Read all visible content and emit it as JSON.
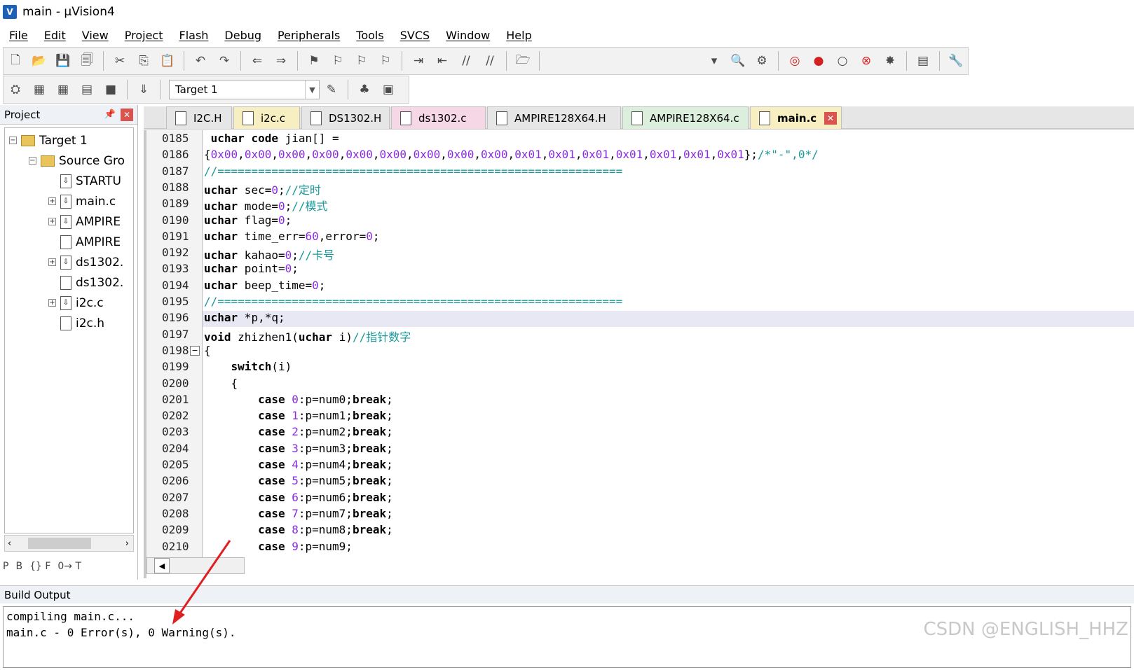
{
  "window": {
    "title": "main  - µVision4"
  },
  "menu": [
    "File",
    "Edit",
    "View",
    "Project",
    "Flash",
    "Debug",
    "Peripherals",
    "Tools",
    "SVCS",
    "Window",
    "Help"
  ],
  "toolbar": {
    "target": "Target 1"
  },
  "project_panel": {
    "title": "Project",
    "tree": [
      {
        "label": "Target 1",
        "kind": "target"
      },
      {
        "label": "Source Gro",
        "kind": "group"
      },
      {
        "label": "STARTU",
        "kind": "file"
      },
      {
        "label": "main.c",
        "kind": "file"
      },
      {
        "label": "AMPIRE",
        "kind": "file"
      },
      {
        "label": "AMPIRE",
        "kind": "header"
      },
      {
        "label": "ds1302.",
        "kind": "file"
      },
      {
        "label": "ds1302.",
        "kind": "header"
      },
      {
        "label": "i2c.c",
        "kind": "file"
      },
      {
        "label": "i2c.h",
        "kind": "header"
      }
    ],
    "tabs": [
      "P",
      "B",
      "{} F",
      "0→ T"
    ]
  },
  "file_tabs": [
    {
      "label": "I2C.H",
      "color": "#e6e6e6"
    },
    {
      "label": "i2c.c",
      "color": "#f7efc2"
    },
    {
      "label": "DS1302.H",
      "color": "#e6e6e6"
    },
    {
      "label": "ds1302.c",
      "color": "#f6d7e5"
    },
    {
      "label": "AMPIRE128X64.H",
      "color": "#e6e6e6"
    },
    {
      "label": "AMPIRE128X64.c",
      "color": "#dcefdc"
    },
    {
      "label": "main.c",
      "color": "#f7efc2",
      "active": true
    }
  ],
  "code_lines": [
    {
      "n": "0185",
      "t": " uchar code jian[] ="
    },
    {
      "n": "0186",
      "t": "{0x00,0x00,0x00,0x00,0x00,0x00,0x00,0x00,0x00,0x01,0x01,0x01,0x01,0x01,0x01,0x01};/*\"-\",0*/"
    },
    {
      "n": "0187",
      "t": "//============================================================"
    },
    {
      "n": "0188",
      "t": "uchar sec=0;//定时"
    },
    {
      "n": "0189",
      "t": "uchar mode=0;//模式"
    },
    {
      "n": "0190",
      "t": "uchar flag=0;"
    },
    {
      "n": "0191",
      "t": "uchar time_err=60,error=0;"
    },
    {
      "n": "0192",
      "t": "uchar kahao=0;//卡号"
    },
    {
      "n": "0193",
      "t": "uchar point=0;"
    },
    {
      "n": "0194",
      "t": "uchar beep_time=0;"
    },
    {
      "n": "0195",
      "t": "//============================================================"
    },
    {
      "n": "0196",
      "t": "uchar *p,*q;"
    },
    {
      "n": "0197",
      "t": "void zhizhen1(uchar i)//指针数字"
    },
    {
      "n": "0198",
      "t": "{"
    },
    {
      "n": "0199",
      "t": "    switch(i)"
    },
    {
      "n": "0200",
      "t": "    {"
    },
    {
      "n": "0201",
      "t": "        case 0:p=num0;break;"
    },
    {
      "n": "0202",
      "t": "        case 1:p=num1;break;"
    },
    {
      "n": "0203",
      "t": "        case 2:p=num2;break;"
    },
    {
      "n": "0204",
      "t": "        case 3:p=num3;break;"
    },
    {
      "n": "0205",
      "t": "        case 4:p=num4;break;"
    },
    {
      "n": "0206",
      "t": "        case 5:p=num5;break;"
    },
    {
      "n": "0207",
      "t": "        case 6:p=num6;break;"
    },
    {
      "n": "0208",
      "t": "        case 7:p=num7;break;"
    },
    {
      "n": "0209",
      "t": "        case 8:p=num8;break;"
    },
    {
      "n": "0210",
      "t": "        case 9:p=num9;"
    }
  ],
  "build": {
    "title": "Build Output",
    "lines": [
      "compiling main.c...",
      "main.c - 0 Error(s), 0 Warning(s)."
    ]
  },
  "watermark": "CSDN @ENGLISH_HHZ",
  "icons": {
    "tb1": [
      "new-file-icon",
      "open-icon",
      "save-icon",
      "save-all-icon",
      "cut-icon",
      "copy-icon",
      "paste-icon",
      "undo-icon",
      "redo-icon",
      "nav-back-icon",
      "nav-forward-icon",
      "bookmark-icon",
      "bookmark-prev-icon",
      "bookmark-next-icon",
      "bookmark-clear-icon",
      "indent-icon",
      "unindent-icon",
      "comment-icon",
      "uncomment-icon",
      "find-in-files-icon",
      "dropdown-icon",
      "find-icon",
      "tools-icon",
      "debug-icon",
      "breakpoint-icon",
      "breakpoint-disable-icon",
      "breakpoint-kill-icon",
      "breakpoint-all-icon",
      "window-icon",
      "settings-icon"
    ],
    "tb2": [
      "build-icon",
      "compile-icon",
      "rebuild-icon",
      "batch-icon",
      "stop-icon",
      "load-icon",
      "options-icon",
      "manage-icon",
      "components-icon"
    ]
  }
}
